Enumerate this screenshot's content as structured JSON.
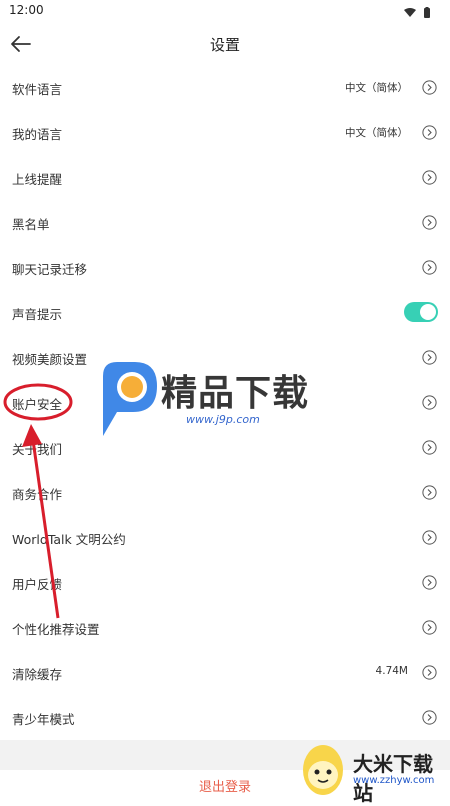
{
  "status_bar": {
    "time": "12:00"
  },
  "header": {
    "title": "设置"
  },
  "settings": [
    {
      "label": "软件语言",
      "value": "中文（简体）",
      "control": "chevron"
    },
    {
      "label": "我的语言",
      "value": "中文（简体）",
      "control": "chevron"
    },
    {
      "label": "上线提醒",
      "value": "",
      "control": "chevron"
    },
    {
      "label": "黑名单",
      "value": "",
      "control": "chevron"
    },
    {
      "label": "聊天记录迁移",
      "value": "",
      "control": "chevron"
    },
    {
      "label": "声音提示",
      "value": "",
      "control": "toggle",
      "toggle_on": true
    },
    {
      "label": "视频美颜设置",
      "value": "",
      "control": "chevron"
    },
    {
      "label": "账户安全",
      "value": "",
      "control": "chevron"
    },
    {
      "label": "关于我们",
      "value": "",
      "control": "chevron"
    },
    {
      "label": "商务合作",
      "value": "",
      "control": "chevron"
    },
    {
      "label": "WorldTalk 文明公约",
      "value": "",
      "control": "chevron"
    },
    {
      "label": "用户反馈",
      "value": "",
      "control": "chevron"
    },
    {
      "label": "个性化推荐设置",
      "value": "",
      "control": "chevron"
    },
    {
      "label": "清除缓存",
      "value": "4.74M",
      "control": "chevron"
    },
    {
      "label": "青少年模式",
      "value": "",
      "control": "chevron"
    }
  ],
  "logout_label": "退出登录",
  "watermark_center": {
    "brand": "精品下载",
    "url": "www.j9p.com"
  },
  "watermark_corner": {
    "brand": "大米下载站",
    "url": "www.zzhyw.com"
  },
  "colors": {
    "accent": "#37d0b5",
    "logout": "#e8604c",
    "annotation": "#d81e2c"
  },
  "icons": [
    "back-arrow-icon",
    "wifi-icon",
    "battery-icon",
    "chevron-right-icon"
  ]
}
